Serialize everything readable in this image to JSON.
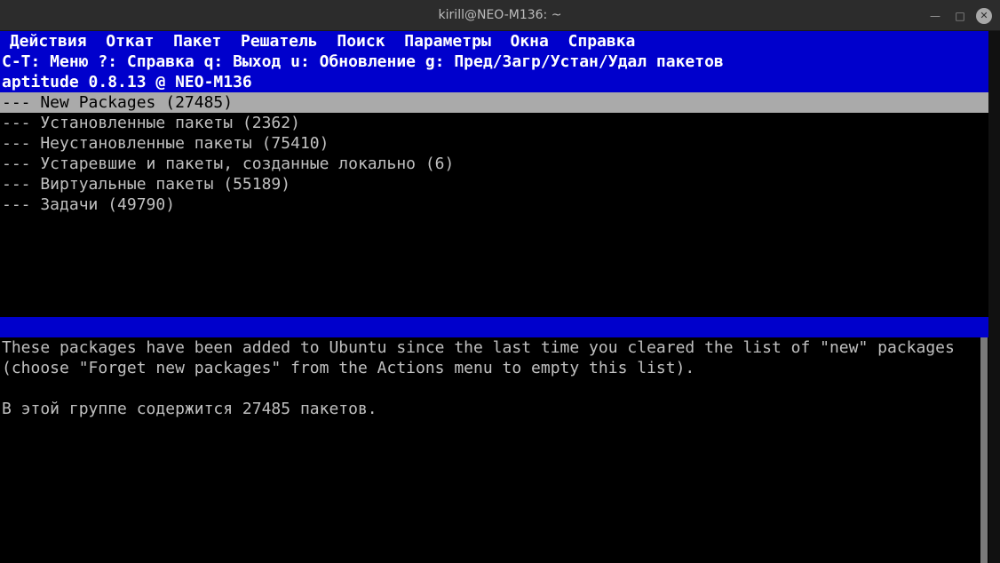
{
  "window": {
    "title": "kirill@NEO-M136: ~",
    "min_glyph": "—",
    "max_glyph": "□",
    "close_glyph": "✕"
  },
  "menu": {
    "items": [
      "Действия",
      "Откат",
      "Пакет",
      "Решатель",
      "Поиск",
      "Параметры",
      "Окна",
      "Справка"
    ]
  },
  "hints": "C-T: Меню ?: Справка q: Выход u: Обновление g: Пред/Загр/Устан/Удал пакетов",
  "version_line": "aptitude 0.8.13 @ NEO-M136",
  "tree": {
    "items": [
      "--- New Packages (27485)",
      "--- Установленные пакеты (2362)",
      "--- Неустановленные пакеты (75410)",
      "--- Устаревшие и пакеты, созданные локально (6)",
      "--- Виртуальные пакеты (55189)",
      "--- Задачи (49790)"
    ],
    "selected_index": 0
  },
  "description": {
    "line1": "These packages have been added to Ubuntu since the last time you cleared the list of \"new\" packages",
    "line2": "(choose \"Forget new packages\" from the Actions menu to empty this list).",
    "line3": "В этой группе содержится 27485 пакетов."
  },
  "colors": {
    "menu_bg": "#0000cc",
    "selection_bg": "#aaaaaa",
    "text": "#c0c0c0",
    "background": "#000000"
  }
}
